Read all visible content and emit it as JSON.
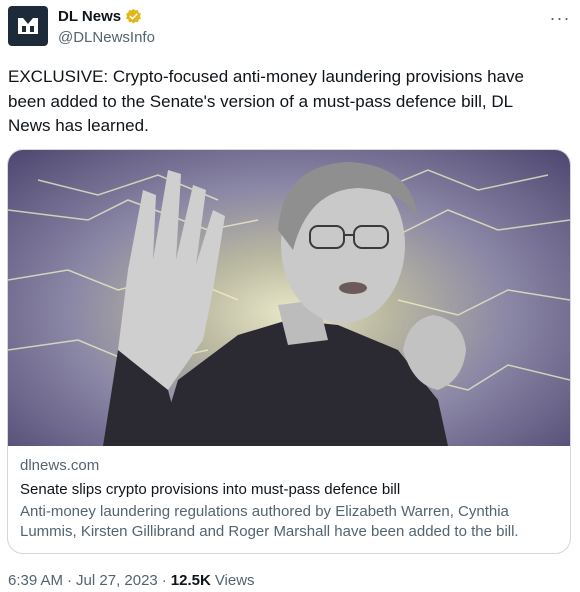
{
  "author": {
    "display_name": "DL News",
    "handle": "@DLNewsInfo",
    "verified": true,
    "avatar_icon": "dl-news-logo-icon",
    "avatar_color": "#1d2a3a",
    "verified_color": "#e2b719"
  },
  "tweet": {
    "text": "EXCLUSIVE: Crypto-focused anti-money laundering provisions have been added to the Senate's version of a must-pass defence bill, DL News has learned."
  },
  "card": {
    "image_icon": "article-photo",
    "domain": "dlnews.com",
    "title": "Senate slips crypto provisions into must-pass defence bill",
    "description": "Anti-money laundering regulations authored by Elizabeth Warren, Cynthia Lummis, Kirsten Gillibrand and Roger Marshall have been added to the bill."
  },
  "footer": {
    "time": "6:39 AM",
    "separator": "·",
    "date": "Jul 27, 2023",
    "views_count": "12.5K",
    "views_label": "Views"
  },
  "more_icon": "more-horizontal-icon",
  "colors": {
    "text_primary": "#0f1419",
    "text_secondary": "#536471",
    "border": "#cfd9de"
  }
}
